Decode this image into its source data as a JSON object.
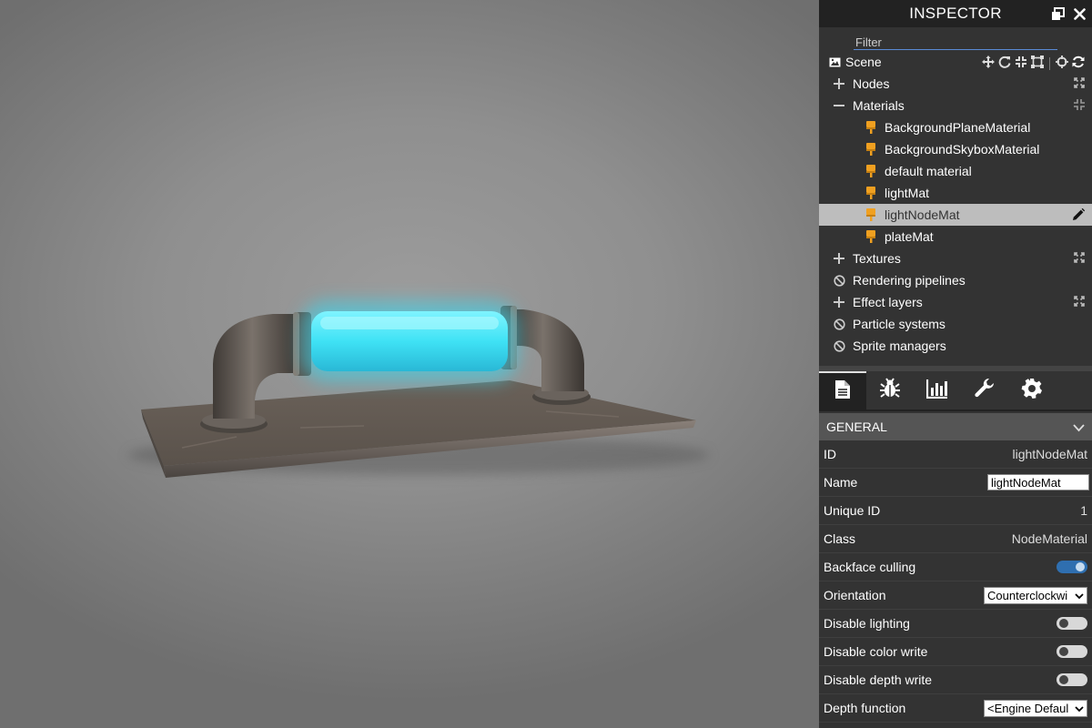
{
  "inspector": {
    "title": "INSPECTOR",
    "filter_placeholder": "Filter",
    "tree": {
      "scene_label": "Scene",
      "nodes_label": "Nodes",
      "materials_label": "Materials",
      "materials": [
        "BackgroundPlaneMaterial",
        "BackgroundSkyboxMaterial",
        "default material",
        "lightMat",
        "lightNodeMat",
        "plateMat"
      ],
      "selected_material": "lightNodeMat",
      "textures_label": "Textures",
      "rendering_pipelines_label": "Rendering pipelines",
      "effect_layers_label": "Effect layers",
      "particle_systems_label": "Particle systems",
      "sprite_managers_label": "Sprite managers"
    },
    "tabs": [
      "properties",
      "debug",
      "statistics",
      "tools",
      "settings"
    ],
    "active_tab": "properties",
    "general": {
      "header": "GENERAL",
      "id_label": "ID",
      "id_value": "lightNodeMat",
      "name_label": "Name",
      "name_value": "lightNodeMat",
      "unique_id_label": "Unique ID",
      "unique_id_value": "1",
      "class_label": "Class",
      "class_value": "NodeMaterial",
      "backface_label": "Backface culling",
      "backface_on": true,
      "orientation_label": "Orientation",
      "orientation_value": "Counterclockwi",
      "disable_lighting_label": "Disable lighting",
      "disable_lighting_on": false,
      "disable_color_write_label": "Disable color write",
      "disable_color_write_on": false,
      "disable_depth_write_label": "Disable depth write",
      "disable_depth_write_on": false,
      "depth_function_label": "Depth function",
      "depth_function_value": "<Engine Defaul"
    }
  },
  "colors": {
    "panel_bg": "#333333",
    "header_bg": "#222222",
    "selected_row": "#bdbdbd",
    "material_icon": "#f0a020",
    "toggle_on": "#2f6fb0",
    "accent_line": "#5a8bd6"
  }
}
